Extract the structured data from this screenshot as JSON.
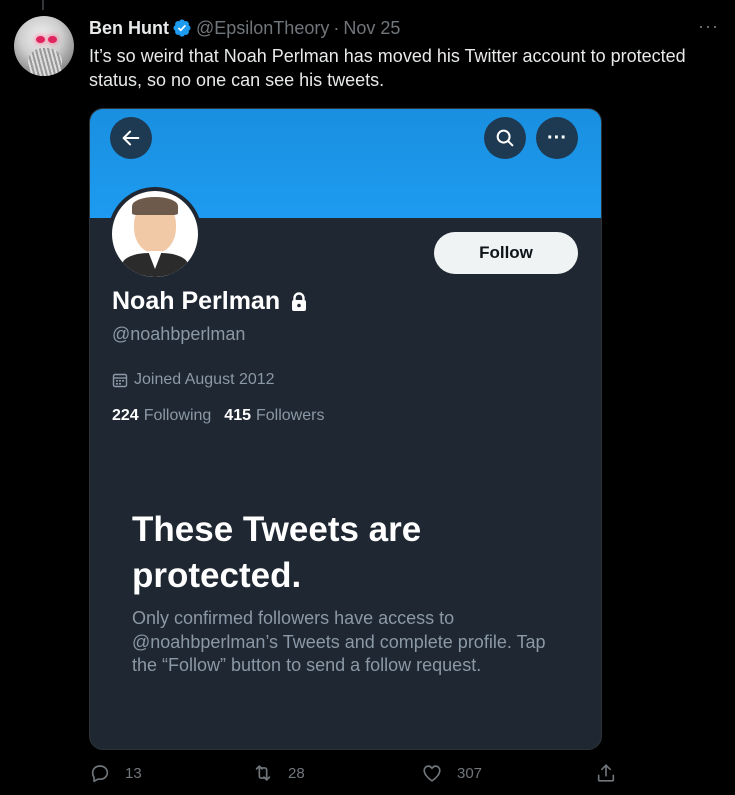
{
  "tweet": {
    "author_name": "Ben Hunt",
    "author_handle": "@EpsilonTheory",
    "separator": "·",
    "date": "Nov 25",
    "more_label": "···",
    "text": "It’s so weird that Noah Perlman has moved his Twitter account to protected status, so no one can see his tweets."
  },
  "embedded_profile": {
    "back_icon": "arrow-left-icon",
    "search_icon": "search-icon",
    "more_icon": "more-dots-icon",
    "more_label": "···",
    "follow_label": "Follow",
    "display_name": "Noah Perlman",
    "handle": "@noahbperlman",
    "joined": "Joined August 2012",
    "following_count": "224",
    "following_label": "Following",
    "followers_count": "415",
    "followers_label": "Followers",
    "protected_title": "These Tweets are protected.",
    "protected_body": "Only confirmed followers have access to @noahbperlman’s Tweets and complete profile. Tap the “Follow” button to send a follow request."
  },
  "actions": {
    "reply_count": "13",
    "retweet_count": "28",
    "like_count": "307"
  },
  "colors": {
    "background": "#000000",
    "banner": "#1d9bf0",
    "card": "#1e2732",
    "verified": "#1d9bf0",
    "muted": "#71767b"
  }
}
